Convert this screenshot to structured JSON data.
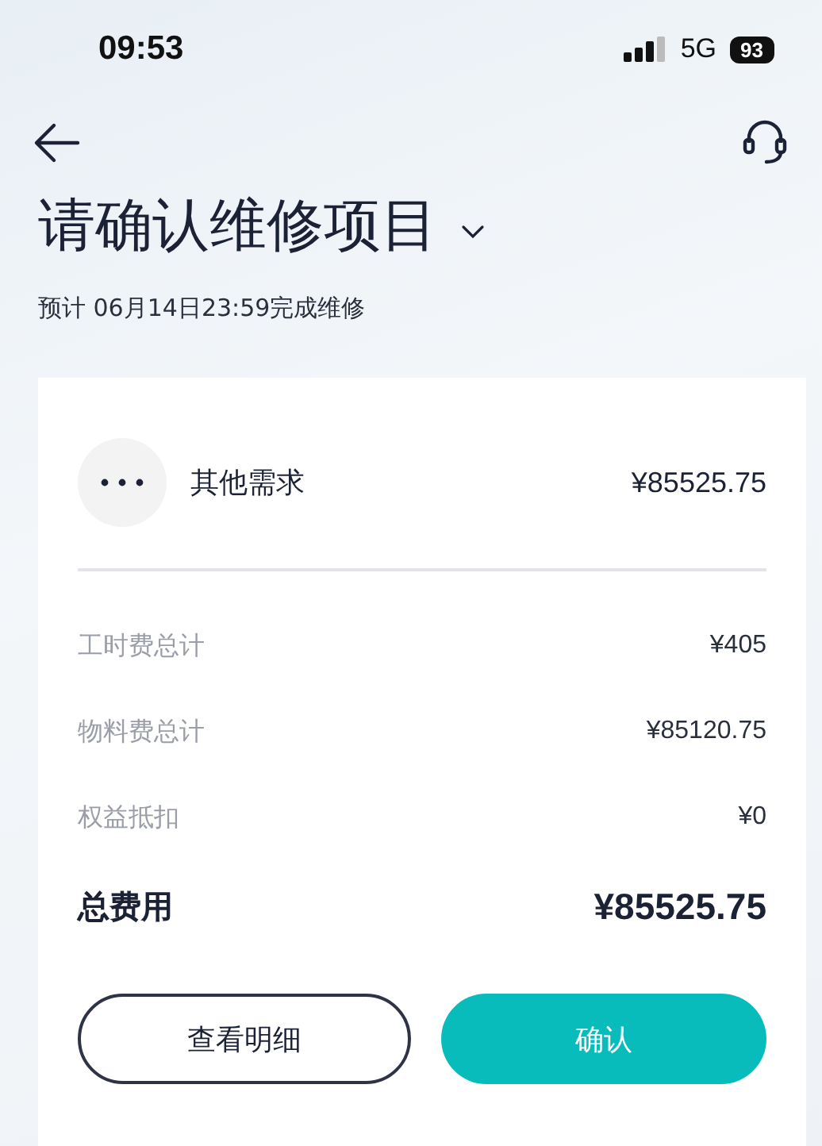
{
  "status_bar": {
    "time": "09:53",
    "network": "5G",
    "battery": "93"
  },
  "header": {
    "title": "请确认维修项目",
    "subtitle": "预计 06月14日23:59完成维修"
  },
  "card": {
    "item": {
      "name": "其他需求",
      "price": "¥85525.75"
    },
    "fees": [
      {
        "kind": "sub",
        "label": "工时费总计",
        "amount": "¥405"
      },
      {
        "kind": "sub",
        "label": "物料费总计",
        "amount": "¥85120.75"
      },
      {
        "kind": "sub",
        "label": "权益抵扣",
        "amount": "¥0"
      },
      {
        "kind": "total",
        "label": "总费用",
        "amount": "¥85525.75"
      }
    ],
    "buttons": [
      {
        "kind": "outline",
        "label": "查看明细"
      },
      {
        "kind": "primary",
        "label": "确认"
      }
    ]
  }
}
